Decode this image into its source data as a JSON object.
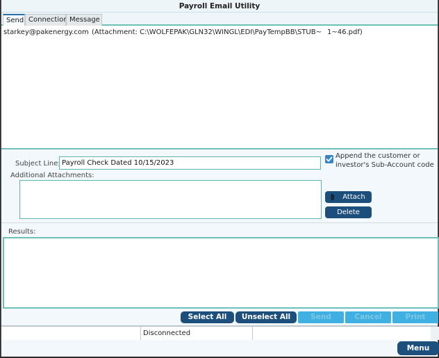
{
  "window": {
    "title": "Payroll Email Utility"
  },
  "tabs": [
    {
      "label": "Send",
      "active": true
    },
    {
      "label": "Connection",
      "active": false
    },
    {
      "label": "Message",
      "active": false
    }
  ],
  "email_list": {
    "rows": [
      {
        "address": "starkey@pakenergy.com",
        "attachment": "(Attachment: C:\\WOLFEPAK\\GLN32\\WINGL\\EDI\\PayTempBB\\STUB~",
        "attachment_tail": "1~46.pdf)"
      }
    ]
  },
  "form": {
    "subject_label": "Subject Line:",
    "subject_value": "Payroll Check Dated 10/15/2023",
    "additional_label": "Additional Attachments:",
    "append_checkbox": {
      "checked": true,
      "label": "Append the customer or investor's Sub-Account code"
    },
    "attach_label": "Attach",
    "delete_label": "Delete"
  },
  "results": {
    "label": "Results:"
  },
  "actions": {
    "select_all": "Select All",
    "unselect_all": "Unselect All",
    "send": "Send",
    "cancel": "Cancel",
    "print": "Print"
  },
  "status": {
    "cell1": "",
    "cell2": "Disconnected",
    "cell3": ""
  },
  "bottom": {
    "menu_label": "Menu"
  },
  "colors": {
    "primary_button": "#1d4f7c",
    "disabled_button": "#40b0e2",
    "accent_border": "#6cbfb8",
    "checkbox": "#3a85c6"
  }
}
